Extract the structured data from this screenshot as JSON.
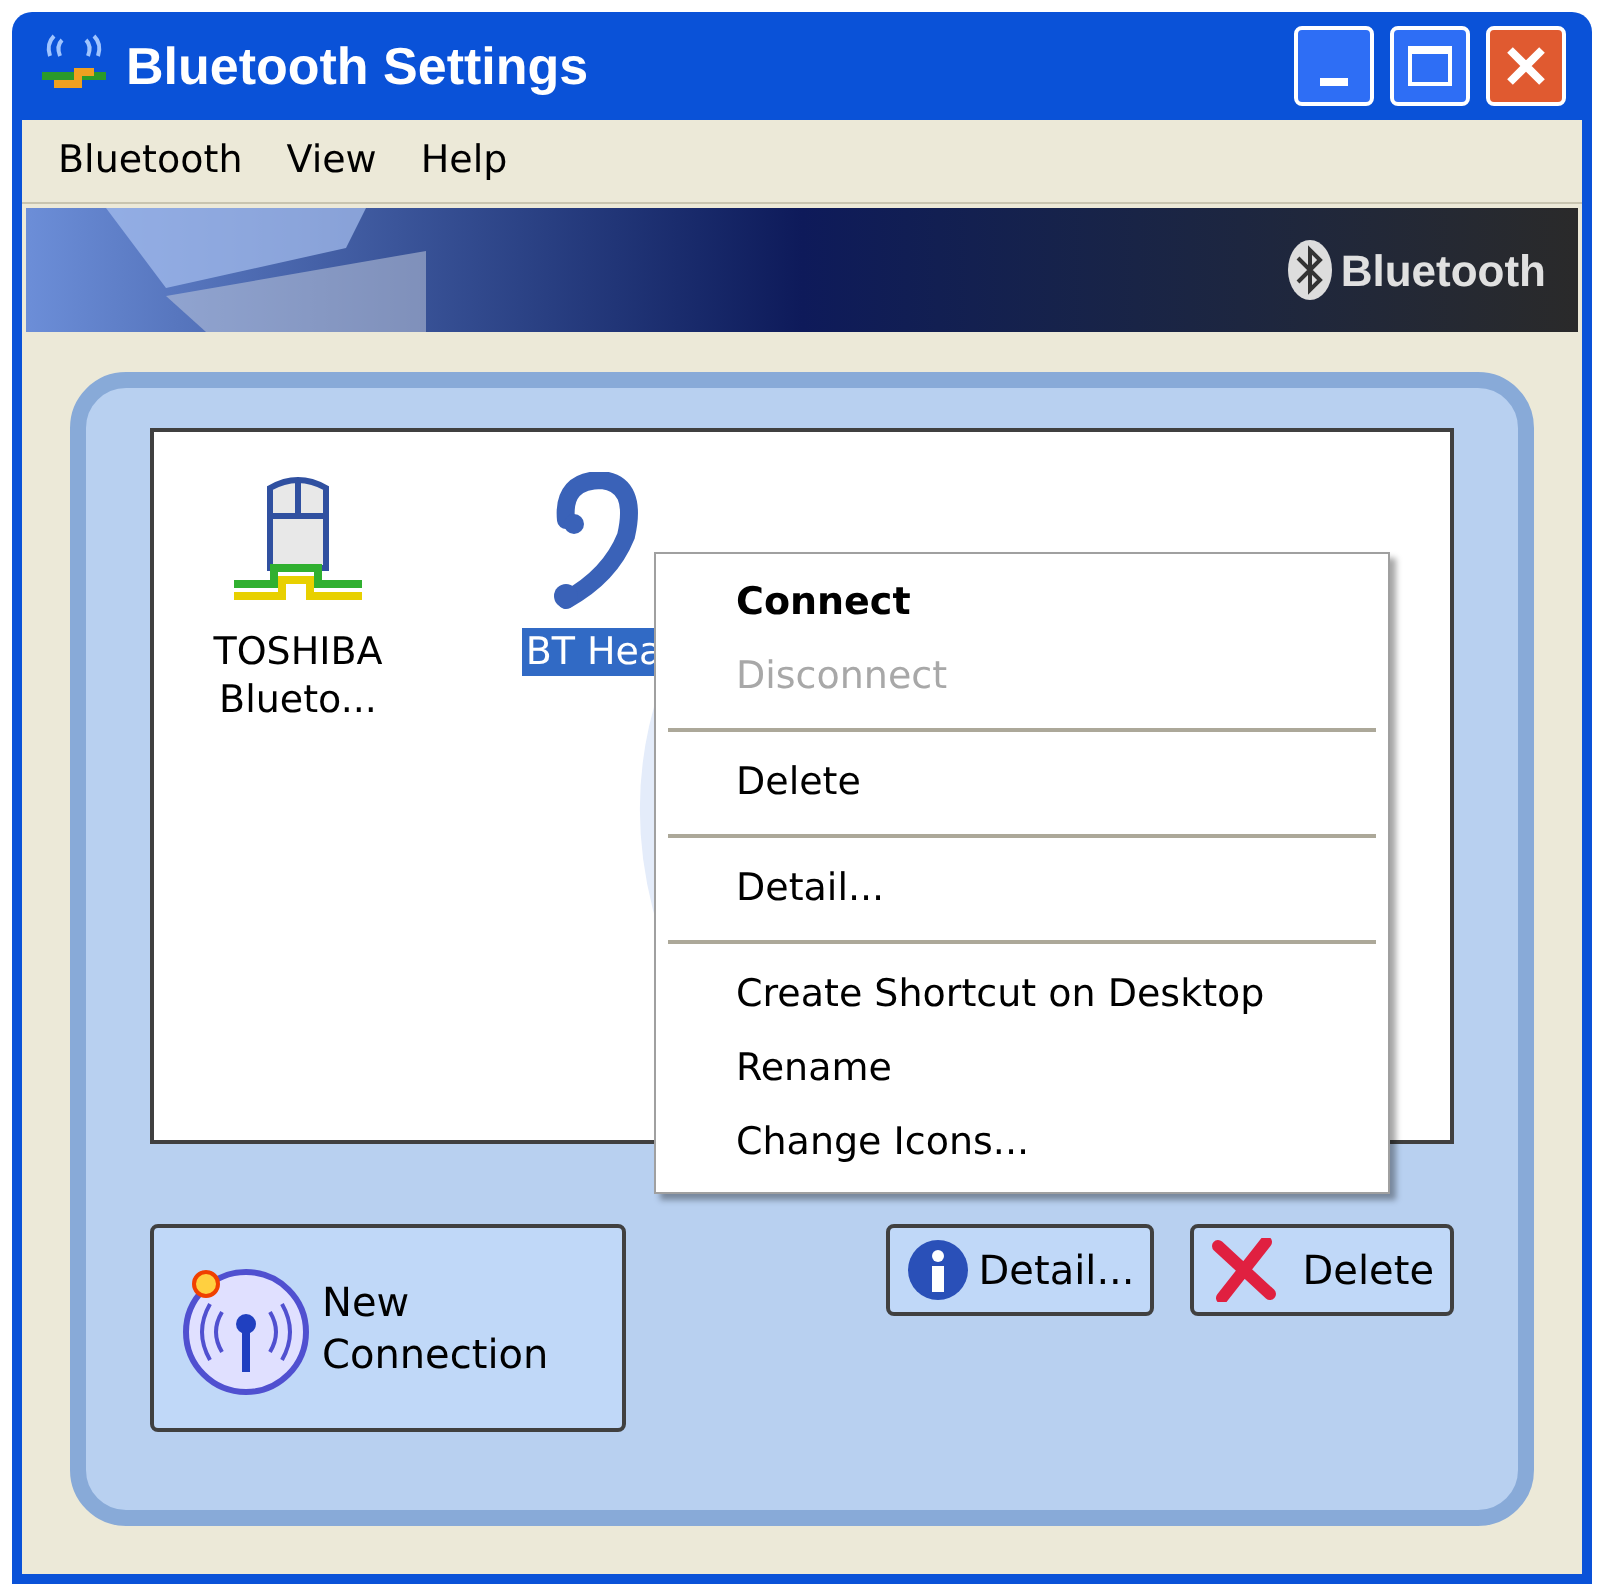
{
  "window": {
    "title": "Bluetooth Settings"
  },
  "menu_bar": [
    "Bluetooth",
    "View",
    "Help"
  ],
  "banner": {
    "brand": "Bluetooth"
  },
  "devices": [
    {
      "kind": "mouse",
      "label": "TOSHIBA Blueto...",
      "selected": false
    },
    {
      "kind": "headset",
      "label": "BT Hea",
      "selected": true
    }
  ],
  "context_menu": [
    {
      "kind": "item",
      "label": "Connect",
      "default": true,
      "disabled": false
    },
    {
      "kind": "item",
      "label": "Disconnect",
      "default": false,
      "disabled": true
    },
    {
      "kind": "separator"
    },
    {
      "kind": "item",
      "label": "Delete",
      "default": false,
      "disabled": false
    },
    {
      "kind": "separator"
    },
    {
      "kind": "item",
      "label": "Detail...",
      "default": false,
      "disabled": false
    },
    {
      "kind": "separator"
    },
    {
      "kind": "item",
      "label": "Create Shortcut on Desktop",
      "default": false,
      "disabled": false
    },
    {
      "kind": "item",
      "label": "Rename",
      "default": false,
      "disabled": false
    },
    {
      "kind": "item",
      "label": "Change Icons...",
      "default": false,
      "disabled": false
    }
  ],
  "buttons": [
    {
      "kind": "new",
      "label": "New Connection"
    },
    {
      "kind": "detail",
      "label": "Detail..."
    },
    {
      "kind": "delete",
      "label": "Delete"
    }
  ]
}
